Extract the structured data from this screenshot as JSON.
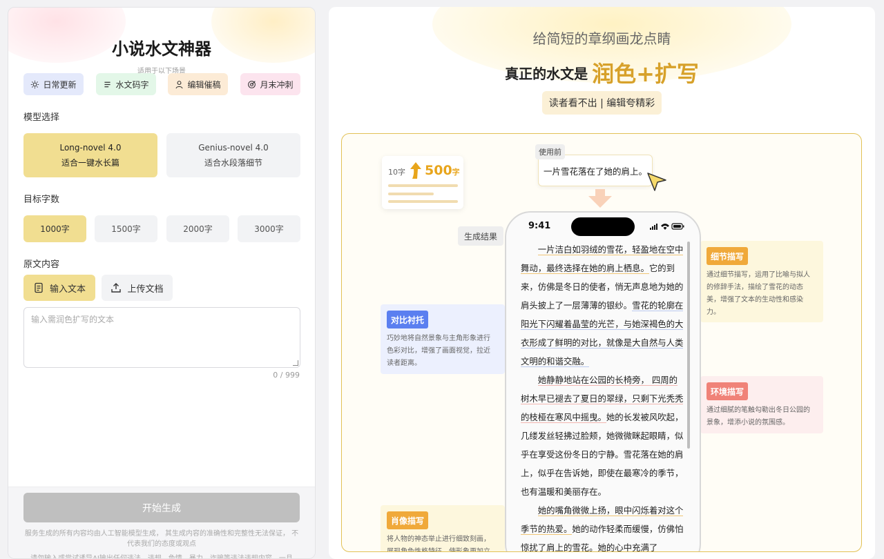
{
  "left_panel": {
    "title": "小说水文神器",
    "subtitle": "适用于以下场景",
    "scenes": [
      {
        "label": "日常更新",
        "icon": "sun-icon",
        "bg": "#e4e9fb"
      },
      {
        "label": "水文码字",
        "icon": "lines-icon",
        "bg": "#e3f7e8"
      },
      {
        "label": "编辑催稿",
        "icon": "user-icon",
        "bg": "#fcebd6"
      },
      {
        "label": "月末冲刺",
        "icon": "target-icon",
        "bg": "#fce4ee"
      }
    ],
    "model_label": "模型选择",
    "models": [
      {
        "name": "Long-novel 4.0",
        "desc": "适合一键水长篇",
        "active": true
      },
      {
        "name": "Genius-novel 4.0",
        "desc": "适合水段落细节",
        "active": false
      }
    ],
    "target_label": "目标字数",
    "word_counts": [
      "1000字",
      "1500字",
      "2000字",
      "3000字"
    ],
    "word_count_selected": "1000字",
    "source_label": "原文内容",
    "source_buttons": [
      {
        "label": "输入文本",
        "icon": "document-icon",
        "active": true
      },
      {
        "label": "上传文档",
        "icon": "upload-icon",
        "active": false
      }
    ],
    "textarea_placeholder": "输入需润色扩写的文本",
    "counter": "0 / 999",
    "generate_button": "开始生成",
    "disclaimer": "服务生成的所有内容均由人工智能模型生成， 其生成内容的准确性和完整性无法保证， 不代表我们的态度或观点",
    "disclaimer_2": "请勿输入或尝试诱导AI输出任何违法、违规、色情、暴力、诈骗等违法违规内容，一旦"
  },
  "right_panel": {
    "tagline": "给简短的章纲画龙点睛",
    "headline_prefix": "真正的水文是",
    "headline_highlight": "润色+扩写",
    "pill": "读者看不出 | 编辑夸精彩",
    "stat": {
      "from": "10字",
      "to_num": "500",
      "to_unit": "字"
    },
    "before_tag": "使用前",
    "before_text": "一片雪花落在了她的肩上。",
    "result_tag": "生成结果",
    "annotations": [
      {
        "badge": "对比衬托",
        "color": "#5b7ff0",
        "desc_lines": [
          "巧妙地将自然景象与主角形象进行",
          "色彩对比，增强了画面视觉，拉近",
          "读者距离。"
        ]
      },
      {
        "badge": "细节描写",
        "color": "#f0a93a",
        "desc_lines": [
          "通过细节描写，运用了比喻与拟人",
          "的修辞手法，描绘了雪花的动态",
          "美，增强了文本的生动性和感染",
          "力。"
        ]
      },
      {
        "badge": "环境描写",
        "color": "#f08278",
        "desc_lines": [
          "通过细腻的笔触勾勒出冬日公园的",
          "景象，增添小说的氛围感。"
        ]
      },
      {
        "badge": "肖像描写",
        "color": "#f0a93a",
        "desc_lines": [
          "将人物的神态举止进行细致刻画，",
          "展现角色性格特征，使形象更加立"
        ]
      }
    ],
    "phone": {
      "time": "9:41",
      "paragraph_1": [
        {
          "text": "一片洁白如羽绒的雪花，轻盈地在空中舞动，最终选择在她的肩上栖息。",
          "style": "gold"
        },
        {
          "text": "它的到来，仿佛是冬日的使者，悄无声息地为她的肩头披上了一层薄薄的银纱。",
          "style": "none"
        },
        {
          "text": "雪花的轮廓在阳光下闪耀着晶莹的光芒，与她深褐色的大衣形成了鲜明的对比，就像是大自然与人类文明的和谐交融。",
          "style": "blue"
        }
      ],
      "paragraph_2": [
        {
          "text": "她静静地站在公园的长椅旁， 四周的树木早已褪去了夏日的翠绿，只剩下光秃秃的枝桠在寒风中摇曳。",
          "style": "red"
        },
        {
          "text": "她的长发被风吹起，几缕发丝轻拂过脸颊，她微微眯起眼睛，似乎在享受这份冬日的宁静。雪花落在她的肩上，似乎在告诉她，即使在最寒冷的季节，也有温暖和美丽存在。",
          "style": "none"
        }
      ],
      "paragraph_3": [
        {
          "text": "她的嘴角微微上扬，眼中闪烁着对这个季节的热爱。",
          "style": "gold"
        },
        {
          "text": "她的动作轻柔而缓慢，仿佛怕惊扰了肩上的雪花。她的心中充满了",
          "style": "none"
        }
      ]
    }
  }
}
